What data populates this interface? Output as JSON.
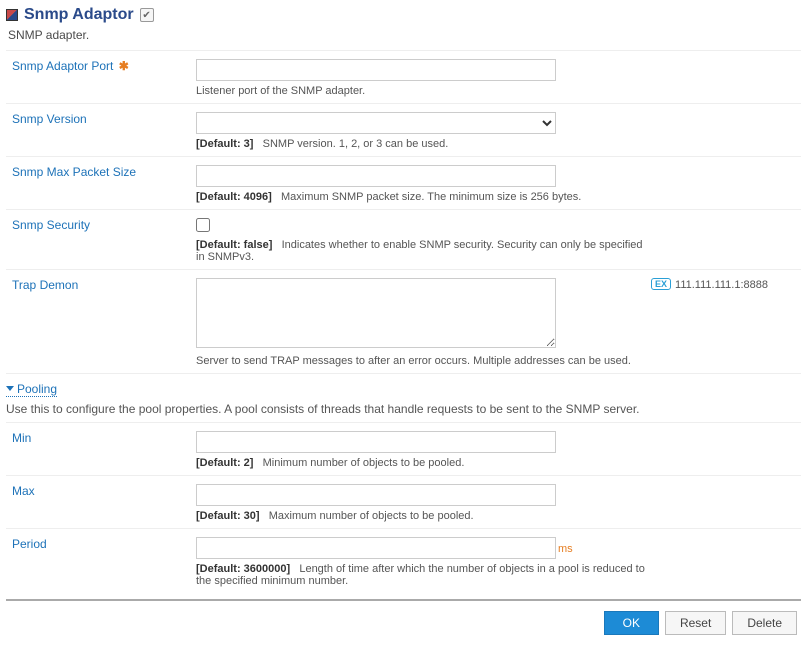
{
  "header": {
    "title": "Snmp Adaptor",
    "subtitle": "SNMP adapter."
  },
  "fields": {
    "port": {
      "label": "Snmp Adaptor Port",
      "required_marker": "✱",
      "value": "",
      "help": "Listener port of the SNMP adapter."
    },
    "version": {
      "label": "Snmp Version",
      "value": "",
      "default": "[Default: 3]",
      "help": "SNMP version. 1, 2, or 3 can be used."
    },
    "maxPacket": {
      "label": "Snmp Max Packet Size",
      "value": "",
      "default": "[Default: 4096]",
      "help": "Maximum SNMP packet size. The minimum size is 256 bytes."
    },
    "security": {
      "label": "Snmp Security",
      "checked": false,
      "default": "[Default: false]",
      "help": "Indicates whether to enable SNMP security. Security can only be specified in SNMPv3."
    },
    "trap": {
      "label": "Trap Demon",
      "value": "",
      "help": "Server to send TRAP messages to after an error occurs. Multiple addresses can be used.",
      "example_badge": "EX",
      "example_value": "111.111.111.1:8888"
    }
  },
  "pooling": {
    "heading": "Pooling",
    "desc": "Use this to configure the pool properties. A pool consists of threads that handle requests to be sent to the SNMP server.",
    "min": {
      "label": "Min",
      "value": "",
      "default": "[Default: 2]",
      "help": "Minimum number of objects to be pooled."
    },
    "max": {
      "label": "Max",
      "value": "",
      "default": "[Default: 30]",
      "help": "Maximum number of objects to be pooled."
    },
    "period": {
      "label": "Period",
      "value": "",
      "unit": "ms",
      "default": "[Default: 3600000]",
      "help": "Length of time after which the number of objects in a pool is reduced to the specified minimum number."
    }
  },
  "buttons": {
    "ok": "OK",
    "reset": "Reset",
    "delete": "Delete"
  }
}
